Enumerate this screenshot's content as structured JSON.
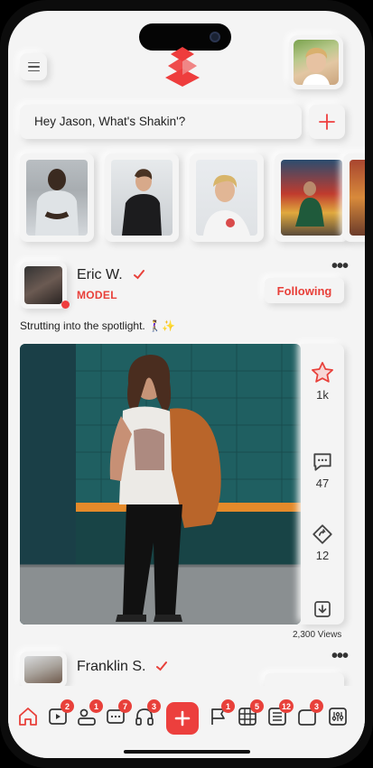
{
  "colors": {
    "accent": "#E8403A",
    "background": "#F4F4F4",
    "text": "#222222"
  },
  "header": {
    "menu_icon": "hamburger-icon",
    "logo_icon": "stacked-diamond-logo",
    "profile_avatar": "user-avatar"
  },
  "status_prompt": {
    "placeholder": "Hey Jason, What's Shakin'?",
    "add_icon": "plus-icon"
  },
  "stories": [
    {
      "name": "story-1"
    },
    {
      "name": "story-2"
    },
    {
      "name": "story-3"
    },
    {
      "name": "story-4"
    },
    {
      "name": "story-5"
    }
  ],
  "post": {
    "author": "Eric W.",
    "tag": "MODEL",
    "follow_label": "Following",
    "caption": "Strutting into the spotlight. 🚶‍♀️✨",
    "likes": "1k",
    "comments": "47",
    "shares": "12",
    "views": "2,300 Views"
  },
  "post2": {
    "author": "Franklin S."
  },
  "tabbar": {
    "items": [
      {
        "icon": "home-icon",
        "badge": ""
      },
      {
        "icon": "video-icon",
        "badge": "2"
      },
      {
        "icon": "friends-icon",
        "badge": "1"
      },
      {
        "icon": "chat-icon",
        "badge": "7"
      },
      {
        "icon": "headphones-icon",
        "badge": "3"
      },
      {
        "icon": "add-icon",
        "badge": ""
      },
      {
        "icon": "flag-icon",
        "badge": "1"
      },
      {
        "icon": "grid-icon",
        "badge": "5"
      },
      {
        "icon": "list-icon",
        "badge": "12"
      },
      {
        "icon": "tag-icon",
        "badge": "3"
      },
      {
        "icon": "settings-icon",
        "badge": ""
      }
    ]
  }
}
